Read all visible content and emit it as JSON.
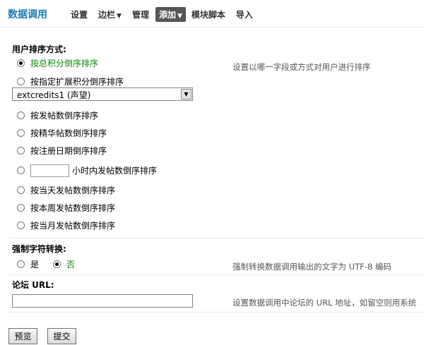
{
  "app": {
    "title": "数据调用"
  },
  "nav": {
    "items": [
      {
        "label": "设置"
      },
      {
        "label": "边栏"
      },
      {
        "label": "管理"
      },
      {
        "label": "添加"
      },
      {
        "label": "模块脚本"
      },
      {
        "label": "导入"
      }
    ],
    "caret": "▼"
  },
  "sort": {
    "title": "用户排序方式:",
    "hint": "设置以哪一字段或方式对用户进行排序",
    "options": [
      {
        "label": "按总积分倒序排序",
        "checked": true
      },
      {
        "label": "按指定扩展积分倒序排序",
        "checked": false
      },
      {
        "label": "按发帖数倒序排序",
        "checked": false
      },
      {
        "label": "按精华帖数倒序排序",
        "checked": false
      },
      {
        "label": "按注册日期倒序排序",
        "checked": false
      },
      {
        "label": "小时内发帖数倒序排序",
        "checked": false
      },
      {
        "label": "按当天发帖数倒序排序",
        "checked": false
      },
      {
        "label": "按本周发帖数倒序排序",
        "checked": false
      },
      {
        "label": "按当月发帖数倒序排序",
        "checked": false
      }
    ],
    "credit_select": {
      "value": "extcredits1 (声望)"
    },
    "hours_value": ""
  },
  "charset": {
    "title": "强制字符转换:",
    "hint": "强制转换数据调用输出的文字为 UTF-8 编码",
    "yes_label": "是",
    "no_label": "否",
    "selected": "no"
  },
  "url": {
    "title": "论坛 URL:",
    "hint": "设置数据调用中论坛的 URL 地址，如留空则用系统",
    "value": ""
  },
  "buttons": {
    "preview": "预览",
    "submit": "提交"
  }
}
